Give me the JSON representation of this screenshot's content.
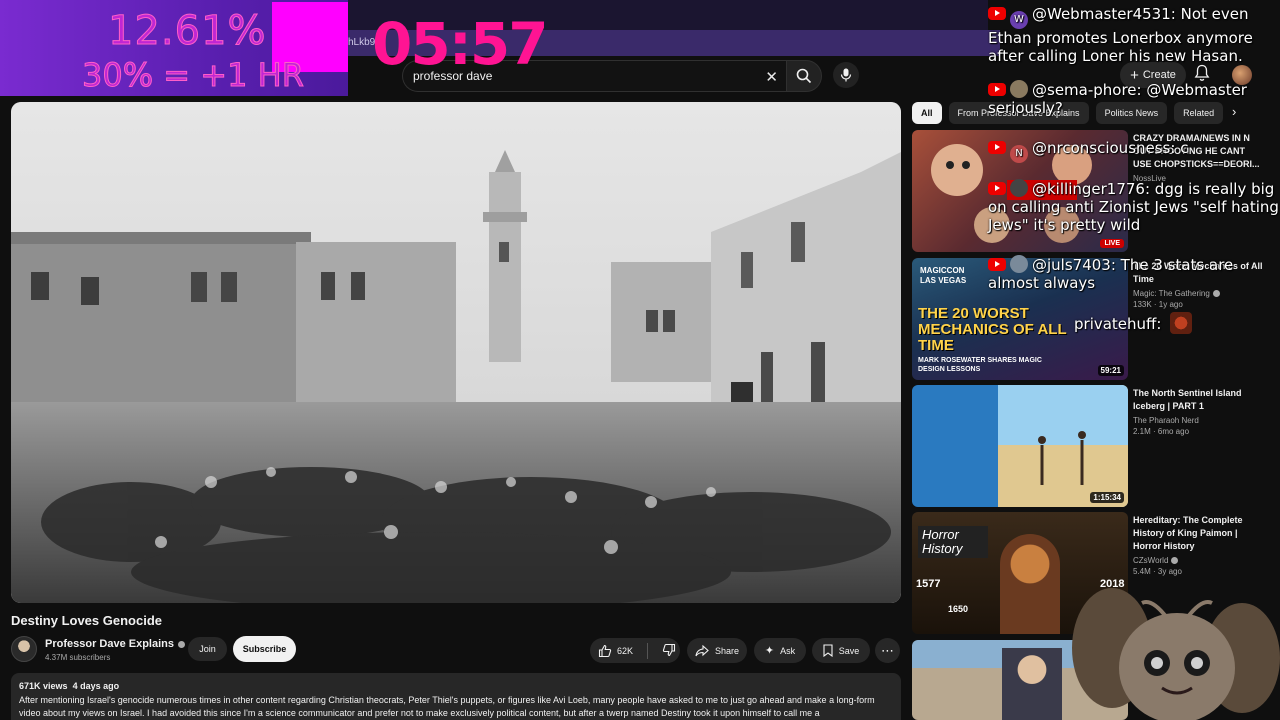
{
  "search": {
    "value": "professor dave",
    "placeholder": "Search"
  },
  "header": {
    "url_fragment": "hLkb9",
    "create_label": "Create"
  },
  "overlay": {
    "stat_percent": "12.61%",
    "stat_rule": "30% = +1 HR",
    "timer": "05:57"
  },
  "video": {
    "title": "Destiny Loves Genocide",
    "channel": "Professor Dave Explains",
    "subscribers": "4.37M subscribers",
    "join_label": "Join",
    "subscribe_label": "Subscribe",
    "likes": "62K",
    "share_label": "Share",
    "ask_label": "Ask",
    "save_label": "Save",
    "views": "671K views",
    "age": "4 days ago",
    "description": "After mentioning Israel's genocide numerous times in other content regarding Christian theocrats, Peter Thiel's puppets, or figures like Avi Loeb, many people have asked to me to just go ahead and make a long-form video about my views on Israel. I had avoided this since I'm a science communicator and prefer not to make exclusively political content, but after a twerp named Destiny took it upon himself to call me a"
  },
  "chips": [
    {
      "label": "All"
    },
    {
      "label": "From Professor Dave Explains"
    },
    {
      "label": "Politics News"
    },
    {
      "label": "Related"
    }
  ],
  "recommendations": [
    {
      "title": "CRAZY DRAMA/NEWS IN N OUT SHOOTING HE CANT USE CHOPSTICKS==DEORI...",
      "channel": "NossLive",
      "meta": "",
      "badge": "LIVE",
      "thumb_color": "#8a3a2a"
    },
    {
      "title": "The 20 Worst Mechanics of All Time",
      "channel": "Magic: The Gathering",
      "meta": "133K · 1y ago",
      "badge": "59:21",
      "thumb_text": "THE 20 WORST MECHANICS OF ALL TIME",
      "thumb_sub": "MARK ROSEWATER SHARES MAGIC DESIGN LESSONS",
      "thumb_logo": "MAGICCON LAS VEGAS"
    },
    {
      "title": "The North Sentinel Island Iceberg | PART 1",
      "channel": "The Pharaoh Nerd",
      "meta": "2.1M · 6mo ago",
      "badge": "1:15:34"
    },
    {
      "title": "Hereditary: The Complete History of King Paimon | Horror History",
      "channel": "CZsWorld",
      "meta": "5.4M · 3y ago",
      "badge": "",
      "thumb_text": "Horror History",
      "thumb_years": [
        "1577",
        "1650",
        "2018"
      ]
    },
    {
      "title": "",
      "channel": "",
      "meta": "",
      "badge": ""
    }
  ],
  "chat": [
    {
      "user": "@Webmaster4531:",
      "avatar": "W",
      "text": "Not even Ethan promotes Lonerbox anymore after calling Loner his new Hasan."
    },
    {
      "user": "@sema-phore:",
      "avatar": "",
      "text": "@Webmaster seriously?"
    },
    {
      "user": "@nrconsciousness:",
      "avatar": "N",
      "text": "c"
    },
    {
      "user": "@killinger1776:",
      "avatar": "",
      "text": "dgg is really big on calling anti Zionist Jews \"self hating Jews\" it's pretty wild"
    },
    {
      "user": "@juls7403:",
      "avatar": "",
      "text": "The 3 stats are almost always"
    },
    {
      "user": "privatehuff:",
      "avatar": "",
      "text": ""
    }
  ]
}
